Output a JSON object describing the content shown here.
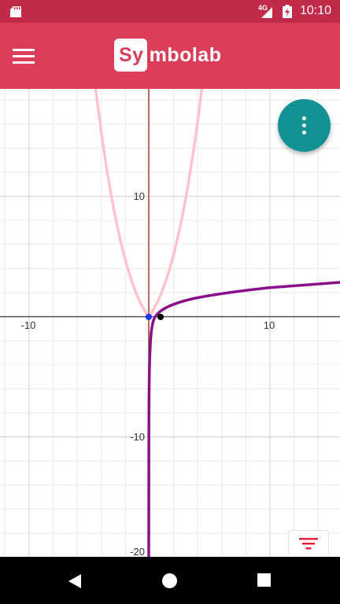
{
  "status_bar": {
    "network": "4G",
    "time": "10:10"
  },
  "app_bar": {
    "logo_highlight": "Sy",
    "logo_rest": "mbolab"
  },
  "graph": {
    "x_ticks": [
      "-10",
      "10"
    ],
    "y_ticks": [
      "10",
      "-10",
      "-20"
    ],
    "axis_color": "#9b3f2a",
    "curves": [
      {
        "function": "parabola (pink)",
        "color": "#ffc2cc"
      },
      {
        "function": "log curve (purple)",
        "color": "#8b0f8b"
      }
    ],
    "points": [
      {
        "x": 0,
        "y": 0,
        "color": "#1a35ff"
      },
      {
        "x": 1,
        "y": 0,
        "color": "#000000"
      }
    ]
  },
  "colors": {
    "app_bar": "#dc3d5a",
    "status_bar": "#c22a4a",
    "fab": "#139296",
    "filter_icon": "#e8213f"
  },
  "icons": {
    "menu": "hamburger-icon",
    "fab": "more-vert-icon",
    "filter": "filter-icon",
    "nav_back": "back-triangle-icon",
    "nav_home": "home-circle-icon",
    "nav_recents": "recents-square-icon"
  }
}
